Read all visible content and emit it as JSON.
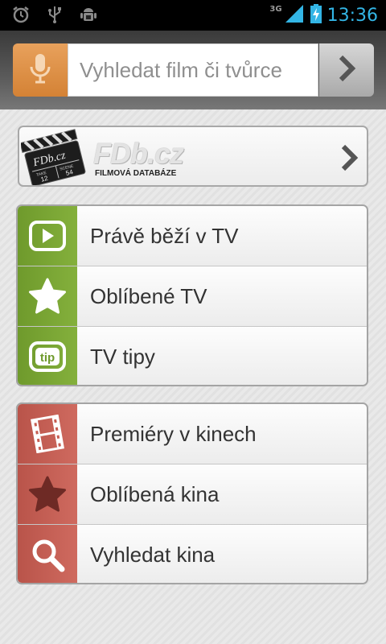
{
  "status_bar": {
    "network": "3G",
    "time": "13:36",
    "left_icons": [
      "alarm-icon",
      "usb-icon",
      "android-debug-icon"
    ],
    "right_icons": [
      "signal-icon",
      "battery-charging-icon"
    ]
  },
  "search": {
    "placeholder": "Vyhledat film či tvůrce",
    "value": ""
  },
  "fdb": {
    "logo": "FDb.cz",
    "subtitle": "FILMOVÁ DATABÁZE",
    "clapper_text": "FDb.cz",
    "clapper_take_label": "TAKE",
    "clapper_take": "12",
    "clapper_scene_label": "SCENE",
    "clapper_scene": "54"
  },
  "tv_menu": [
    {
      "label": "Právě běží v TV",
      "icon": "play-icon"
    },
    {
      "label": "Oblíbené TV",
      "icon": "star-icon"
    },
    {
      "label": "TV tipy",
      "icon": "tip-icon"
    }
  ],
  "cinema_menu": [
    {
      "label": "Premiéry v kinech",
      "icon": "film-strip-icon"
    },
    {
      "label": "Oblíbená kina",
      "icon": "star-icon"
    },
    {
      "label": "Vyhledat kina",
      "icon": "magnifier-icon"
    }
  ],
  "colors": {
    "tv_accent": "#7aa636",
    "cinema_accent": "#c65d52",
    "mic_accent": "#dd8d45",
    "clock": "#33b5e5"
  }
}
